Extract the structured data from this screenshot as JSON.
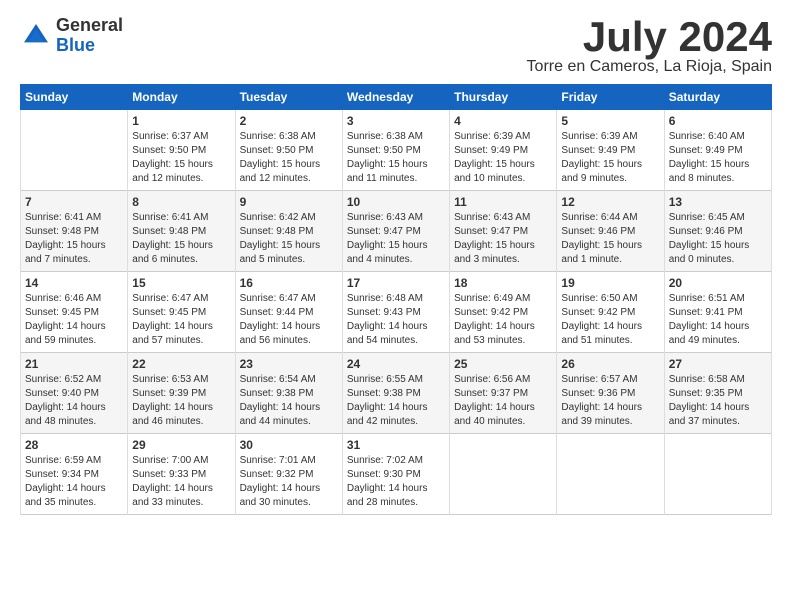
{
  "header": {
    "logo_general": "General",
    "logo_blue": "Blue",
    "month": "July 2024",
    "location": "Torre en Cameros, La Rioja, Spain"
  },
  "weekdays": [
    "Sunday",
    "Monday",
    "Tuesday",
    "Wednesday",
    "Thursday",
    "Friday",
    "Saturday"
  ],
  "weeks": [
    [
      {
        "day": "",
        "info": ""
      },
      {
        "day": "1",
        "info": "Sunrise: 6:37 AM\nSunset: 9:50 PM\nDaylight: 15 hours\nand 12 minutes."
      },
      {
        "day": "2",
        "info": "Sunrise: 6:38 AM\nSunset: 9:50 PM\nDaylight: 15 hours\nand 12 minutes."
      },
      {
        "day": "3",
        "info": "Sunrise: 6:38 AM\nSunset: 9:50 PM\nDaylight: 15 hours\nand 11 minutes."
      },
      {
        "day": "4",
        "info": "Sunrise: 6:39 AM\nSunset: 9:49 PM\nDaylight: 15 hours\nand 10 minutes."
      },
      {
        "day": "5",
        "info": "Sunrise: 6:39 AM\nSunset: 9:49 PM\nDaylight: 15 hours\nand 9 minutes."
      },
      {
        "day": "6",
        "info": "Sunrise: 6:40 AM\nSunset: 9:49 PM\nDaylight: 15 hours\nand 8 minutes."
      }
    ],
    [
      {
        "day": "7",
        "info": "Sunrise: 6:41 AM\nSunset: 9:48 PM\nDaylight: 15 hours\nand 7 minutes."
      },
      {
        "day": "8",
        "info": "Sunrise: 6:41 AM\nSunset: 9:48 PM\nDaylight: 15 hours\nand 6 minutes."
      },
      {
        "day": "9",
        "info": "Sunrise: 6:42 AM\nSunset: 9:48 PM\nDaylight: 15 hours\nand 5 minutes."
      },
      {
        "day": "10",
        "info": "Sunrise: 6:43 AM\nSunset: 9:47 PM\nDaylight: 15 hours\nand 4 minutes."
      },
      {
        "day": "11",
        "info": "Sunrise: 6:43 AM\nSunset: 9:47 PM\nDaylight: 15 hours\nand 3 minutes."
      },
      {
        "day": "12",
        "info": "Sunrise: 6:44 AM\nSunset: 9:46 PM\nDaylight: 15 hours\nand 1 minute."
      },
      {
        "day": "13",
        "info": "Sunrise: 6:45 AM\nSunset: 9:46 PM\nDaylight: 15 hours\nand 0 minutes."
      }
    ],
    [
      {
        "day": "14",
        "info": "Sunrise: 6:46 AM\nSunset: 9:45 PM\nDaylight: 14 hours\nand 59 minutes."
      },
      {
        "day": "15",
        "info": "Sunrise: 6:47 AM\nSunset: 9:45 PM\nDaylight: 14 hours\nand 57 minutes."
      },
      {
        "day": "16",
        "info": "Sunrise: 6:47 AM\nSunset: 9:44 PM\nDaylight: 14 hours\nand 56 minutes."
      },
      {
        "day": "17",
        "info": "Sunrise: 6:48 AM\nSunset: 9:43 PM\nDaylight: 14 hours\nand 54 minutes."
      },
      {
        "day": "18",
        "info": "Sunrise: 6:49 AM\nSunset: 9:42 PM\nDaylight: 14 hours\nand 53 minutes."
      },
      {
        "day": "19",
        "info": "Sunrise: 6:50 AM\nSunset: 9:42 PM\nDaylight: 14 hours\nand 51 minutes."
      },
      {
        "day": "20",
        "info": "Sunrise: 6:51 AM\nSunset: 9:41 PM\nDaylight: 14 hours\nand 49 minutes."
      }
    ],
    [
      {
        "day": "21",
        "info": "Sunrise: 6:52 AM\nSunset: 9:40 PM\nDaylight: 14 hours\nand 48 minutes."
      },
      {
        "day": "22",
        "info": "Sunrise: 6:53 AM\nSunset: 9:39 PM\nDaylight: 14 hours\nand 46 minutes."
      },
      {
        "day": "23",
        "info": "Sunrise: 6:54 AM\nSunset: 9:38 PM\nDaylight: 14 hours\nand 44 minutes."
      },
      {
        "day": "24",
        "info": "Sunrise: 6:55 AM\nSunset: 9:38 PM\nDaylight: 14 hours\nand 42 minutes."
      },
      {
        "day": "25",
        "info": "Sunrise: 6:56 AM\nSunset: 9:37 PM\nDaylight: 14 hours\nand 40 minutes."
      },
      {
        "day": "26",
        "info": "Sunrise: 6:57 AM\nSunset: 9:36 PM\nDaylight: 14 hours\nand 39 minutes."
      },
      {
        "day": "27",
        "info": "Sunrise: 6:58 AM\nSunset: 9:35 PM\nDaylight: 14 hours\nand 37 minutes."
      }
    ],
    [
      {
        "day": "28",
        "info": "Sunrise: 6:59 AM\nSunset: 9:34 PM\nDaylight: 14 hours\nand 35 minutes."
      },
      {
        "day": "29",
        "info": "Sunrise: 7:00 AM\nSunset: 9:33 PM\nDaylight: 14 hours\nand 33 minutes."
      },
      {
        "day": "30",
        "info": "Sunrise: 7:01 AM\nSunset: 9:32 PM\nDaylight: 14 hours\nand 30 minutes."
      },
      {
        "day": "31",
        "info": "Sunrise: 7:02 AM\nSunset: 9:30 PM\nDaylight: 14 hours\nand 28 minutes."
      },
      {
        "day": "",
        "info": ""
      },
      {
        "day": "",
        "info": ""
      },
      {
        "day": "",
        "info": ""
      }
    ]
  ]
}
